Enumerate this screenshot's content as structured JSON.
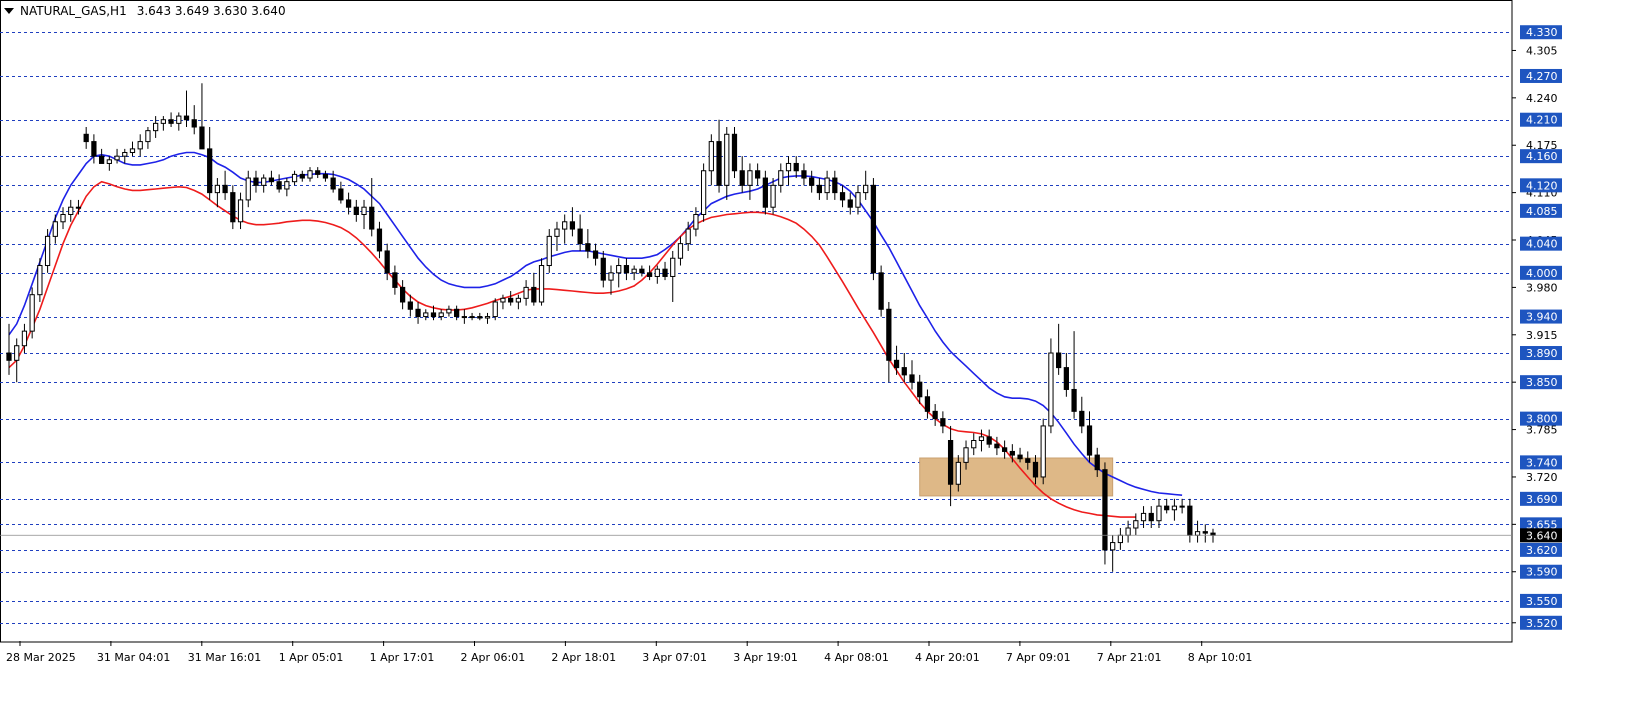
{
  "header": {
    "symbol": "NATURAL_GAS,H1",
    "ohlc": "3.643 3.649 3.630 3.640"
  },
  "colors": {
    "background": "#ffffff",
    "grid": "#1f3fbf",
    "candle": "#000000",
    "ma_fast": "#1e22e8",
    "ma_slow": "#ee1c1c",
    "zone": "#deb887",
    "label_bg": "#1e55c0",
    "price_label_bg": "#000000"
  },
  "chart_data": {
    "type": "candlestick",
    "ylim": [
      3.495,
      4.355
    ],
    "y_ticks": [
      "4.305",
      "4.240",
      "4.175",
      "4.110",
      "4.045",
      "3.980",
      "3.915",
      "3.850",
      "3.785",
      "3.720",
      "3.655",
      "3.590",
      "3.520"
    ],
    "h_lines": [
      "4.330",
      "4.270",
      "4.210",
      "4.160",
      "4.120",
      "4.085",
      "4.040",
      "4.000",
      "3.940",
      "3.890",
      "3.850",
      "3.800",
      "3.740",
      "3.690",
      "3.655",
      "3.620",
      "3.590",
      "3.550",
      "3.520"
    ],
    "current_price": "3.640",
    "x_labels": [
      "28 Mar 2025",
      "31 Mar 04:01",
      "31 Mar 16:01",
      "1 Apr 05:01",
      "1 Apr 17:01",
      "2 Apr 06:01",
      "2 Apr 18:01",
      "3 Apr 07:01",
      "3 Apr 19:01",
      "4 Apr 08:01",
      "4 Apr 20:01",
      "7 Apr 09:01",
      "7 Apr 21:01",
      "8 Apr 10:01"
    ],
    "candles": [
      [
        3.89,
        3.93,
        3.86,
        3.88
      ],
      [
        3.88,
        3.91,
        3.85,
        3.9
      ],
      [
        3.9,
        3.93,
        3.89,
        3.92
      ],
      [
        3.92,
        3.98,
        3.91,
        3.97
      ],
      [
        3.97,
        4.02,
        3.96,
        4.01
      ],
      [
        4.01,
        4.06,
        4.0,
        4.05
      ],
      [
        4.05,
        4.08,
        4.04,
        4.07
      ],
      [
        4.07,
        4.09,
        4.06,
        4.08
      ],
      [
        4.08,
        4.1,
        4.07,
        4.09
      ],
      [
        4.09,
        4.1,
        4.08,
        4.09
      ],
      [
        4.19,
        4.2,
        4.17,
        4.18
      ],
      [
        4.18,
        4.19,
        4.15,
        4.16
      ],
      [
        4.16,
        4.17,
        4.15,
        4.15
      ],
      [
        4.15,
        4.16,
        4.14,
        4.155
      ],
      [
        4.155,
        4.17,
        4.15,
        4.16
      ],
      [
        4.16,
        4.17,
        4.15,
        4.165
      ],
      [
        4.165,
        4.18,
        4.16,
        4.17
      ],
      [
        4.17,
        4.19,
        4.16,
        4.18
      ],
      [
        4.18,
        4.2,
        4.17,
        4.195
      ],
      [
        4.195,
        4.215,
        4.185,
        4.205
      ],
      [
        4.205,
        4.215,
        4.195,
        4.21
      ],
      [
        4.21,
        4.22,
        4.2,
        4.205
      ],
      [
        4.205,
        4.22,
        4.195,
        4.215
      ],
      [
        4.215,
        4.25,
        4.2,
        4.21
      ],
      [
        4.21,
        4.23,
        4.19,
        4.2
      ],
      [
        4.2,
        4.26,
        4.19,
        4.17
      ],
      [
        4.17,
        4.2,
        4.1,
        4.11
      ],
      [
        4.11,
        4.13,
        4.09,
        4.12
      ],
      [
        4.12,
        4.14,
        4.1,
        4.11
      ],
      [
        4.11,
        4.12,
        4.06,
        4.07
      ],
      [
        4.07,
        4.11,
        4.06,
        4.1
      ],
      [
        4.1,
        4.14,
        4.09,
        4.13
      ],
      [
        4.13,
        4.14,
        4.11,
        4.12
      ],
      [
        4.12,
        4.135,
        4.11,
        4.13
      ],
      [
        4.13,
        4.14,
        4.12,
        4.125
      ],
      [
        4.125,
        4.135,
        4.11,
        4.115
      ],
      [
        4.115,
        4.13,
        4.105,
        4.125
      ],
      [
        4.125,
        4.14,
        4.12,
        4.135
      ],
      [
        4.135,
        4.14,
        4.125,
        4.13
      ],
      [
        4.13,
        4.145,
        4.125,
        4.14
      ],
      [
        4.14,
        4.145,
        4.13,
        4.135
      ],
      [
        4.135,
        4.14,
        4.125,
        4.13
      ],
      [
        4.13,
        4.14,
        4.11,
        4.115
      ],
      [
        4.115,
        4.125,
        4.095,
        4.1
      ],
      [
        4.1,
        4.11,
        4.08,
        4.09
      ],
      [
        4.09,
        4.1,
        4.07,
        4.08
      ],
      [
        4.08,
        4.1,
        4.06,
        4.09
      ],
      [
        4.09,
        4.13,
        4.05,
        4.06
      ],
      [
        4.06,
        4.07,
        4.02,
        4.03
      ],
      [
        4.03,
        4.04,
        3.99,
        4.0
      ],
      [
        4.0,
        4.01,
        3.97,
        3.98
      ],
      [
        3.98,
        3.99,
        3.95,
        3.96
      ],
      [
        3.96,
        3.97,
        3.94,
        3.95
      ],
      [
        3.95,
        3.96,
        3.93,
        3.94
      ],
      [
        3.94,
        3.95,
        3.935,
        3.945
      ],
      [
        3.945,
        3.955,
        3.935,
        3.94
      ],
      [
        3.94,
        3.95,
        3.935,
        3.945
      ],
      [
        3.945,
        3.955,
        3.94,
        3.95
      ],
      [
        3.95,
        3.955,
        3.935,
        3.94
      ],
      [
        3.94,
        3.95,
        3.93,
        3.94
      ],
      [
        3.94,
        3.945,
        3.935,
        3.94
      ],
      [
        3.94,
        3.945,
        3.935,
        3.938
      ],
      [
        3.938,
        3.945,
        3.93,
        3.94
      ],
      [
        3.94,
        3.965,
        3.935,
        3.96
      ],
      [
        3.96,
        3.97,
        3.95,
        3.965
      ],
      [
        3.965,
        3.975,
        3.955,
        3.96
      ],
      [
        3.96,
        3.97,
        3.95,
        3.965
      ],
      [
        3.965,
        3.99,
        3.955,
        3.98
      ],
      [
        3.98,
        4.0,
        3.955,
        3.96
      ],
      [
        3.96,
        4.02,
        3.955,
        4.01
      ],
      [
        4.01,
        4.06,
        4.0,
        4.05
      ],
      [
        4.05,
        4.07,
        4.03,
        4.06
      ],
      [
        4.06,
        4.08,
        4.04,
        4.07
      ],
      [
        4.07,
        4.09,
        4.05,
        4.06
      ],
      [
        4.06,
        4.08,
        4.03,
        4.04
      ],
      [
        4.04,
        4.06,
        4.02,
        4.03
      ],
      [
        4.03,
        4.04,
        4.01,
        4.02
      ],
      [
        4.02,
        4.03,
        3.98,
        3.99
      ],
      [
        3.99,
        4.01,
        3.97,
        4.0
      ],
      [
        4.0,
        4.02,
        3.98,
        4.01
      ],
      [
        4.01,
        4.02,
        3.99,
        4.0
      ],
      [
        4.0,
        4.01,
        3.99,
        4.005
      ],
      [
        4.005,
        4.01,
        3.995,
        4.0
      ],
      [
        4.0,
        4.01,
        3.99,
        3.995
      ],
      [
        3.995,
        4.01,
        3.985,
        4.005
      ],
      [
        4.005,
        4.015,
        3.99,
        3.995
      ],
      [
        3.995,
        4.03,
        3.96,
        4.02
      ],
      [
        4.02,
        4.05,
        4.01,
        4.04
      ],
      [
        4.04,
        4.07,
        4.03,
        4.06
      ],
      [
        4.06,
        4.09,
        4.05,
        4.08
      ],
      [
        4.08,
        4.15,
        4.07,
        4.14
      ],
      [
        4.14,
        4.19,
        4.12,
        4.18
      ],
      [
        4.18,
        4.21,
        4.11,
        4.12
      ],
      [
        4.12,
        4.2,
        4.1,
        4.19
      ],
      [
        4.19,
        4.2,
        4.13,
        4.14
      ],
      [
        4.14,
        4.16,
        4.11,
        4.12
      ],
      [
        4.12,
        4.15,
        4.1,
        4.14
      ],
      [
        4.14,
        4.15,
        4.12,
        4.13
      ],
      [
        4.13,
        4.14,
        4.08,
        4.09
      ],
      [
        4.09,
        4.13,
        4.08,
        4.12
      ],
      [
        4.12,
        4.15,
        4.11,
        4.14
      ],
      [
        4.14,
        4.16,
        4.12,
        4.15
      ],
      [
        4.15,
        4.16,
        4.13,
        4.14
      ],
      [
        4.14,
        4.15,
        4.12,
        4.13
      ],
      [
        4.13,
        4.14,
        4.11,
        4.12
      ],
      [
        4.12,
        4.13,
        4.1,
        4.11
      ],
      [
        4.11,
        4.14,
        4.1,
        4.13
      ],
      [
        4.13,
        4.14,
        4.1,
        4.11
      ],
      [
        4.11,
        4.12,
        4.09,
        4.1
      ],
      [
        4.1,
        4.11,
        4.08,
        4.09
      ],
      [
        4.09,
        4.12,
        4.08,
        4.11
      ],
      [
        4.11,
        4.14,
        4.1,
        4.12
      ],
      [
        4.12,
        4.13,
        3.99,
        4.0
      ],
      [
        4.0,
        4.01,
        3.94,
        3.95
      ],
      [
        3.95,
        3.96,
        3.85,
        3.88
      ],
      [
        3.88,
        3.9,
        3.86,
        3.87
      ],
      [
        3.87,
        3.89,
        3.85,
        3.86
      ],
      [
        3.86,
        3.88,
        3.84,
        3.85
      ],
      [
        3.85,
        3.86,
        3.82,
        3.83
      ],
      [
        3.83,
        3.84,
        3.8,
        3.81
      ],
      [
        3.81,
        3.82,
        3.79,
        3.8
      ],
      [
        3.8,
        3.81,
        3.78,
        3.79
      ],
      [
        3.77,
        3.79,
        3.68,
        3.71
      ],
      [
        3.71,
        3.75,
        3.7,
        3.74
      ],
      [
        3.74,
        3.77,
        3.73,
        3.76
      ],
      [
        3.76,
        3.78,
        3.75,
        3.77
      ],
      [
        3.77,
        3.785,
        3.755,
        3.775
      ],
      [
        3.775,
        3.785,
        3.76,
        3.765
      ],
      [
        3.765,
        3.775,
        3.75,
        3.76
      ],
      [
        3.76,
        3.77,
        3.745,
        3.755
      ],
      [
        3.755,
        3.765,
        3.74,
        3.75
      ],
      [
        3.75,
        3.76,
        3.74,
        3.745
      ],
      [
        3.745,
        3.755,
        3.73,
        3.74
      ],
      [
        3.74,
        3.75,
        3.71,
        3.72
      ],
      [
        3.72,
        3.8,
        3.71,
        3.79
      ],
      [
        3.79,
        3.91,
        3.78,
        3.89
      ],
      [
        3.89,
        3.93,
        3.86,
        3.87
      ],
      [
        3.87,
        3.89,
        3.83,
        3.84
      ],
      [
        3.84,
        3.92,
        3.8,
        3.81
      ],
      [
        3.81,
        3.83,
        3.78,
        3.79
      ],
      [
        3.79,
        3.81,
        3.74,
        3.75
      ],
      [
        3.75,
        3.76,
        3.72,
        3.73
      ],
      [
        3.73,
        3.74,
        3.6,
        3.62
      ],
      [
        3.62,
        3.64,
        3.59,
        3.63
      ],
      [
        3.63,
        3.65,
        3.62,
        3.64
      ],
      [
        3.64,
        3.66,
        3.63,
        3.65
      ],
      [
        3.65,
        3.67,
        3.64,
        3.66
      ],
      [
        3.66,
        3.68,
        3.65,
        3.67
      ],
      [
        3.67,
        3.68,
        3.65,
        3.66
      ],
      [
        3.66,
        3.69,
        3.65,
        3.68
      ],
      [
        3.68,
        3.69,
        3.67,
        3.675
      ],
      [
        3.675,
        3.69,
        3.66,
        3.68
      ],
      [
        3.68,
        3.69,
        3.67,
        3.68
      ],
      [
        3.68,
        3.69,
        3.63,
        3.64
      ],
      [
        3.64,
        3.66,
        3.63,
        3.645
      ],
      [
        3.645,
        3.655,
        3.63,
        3.643
      ],
      [
        3.643,
        3.649,
        3.63,
        3.64
      ]
    ],
    "series": [
      {
        "name": "",
        "color": "#1e22e8",
        "values": [
          3.915,
          3.93,
          3.955,
          3.985,
          4.015,
          4.045,
          4.075,
          4.1,
          4.12,
          4.135,
          4.15,
          4.16,
          4.162,
          4.16,
          4.155,
          4.15,
          4.148,
          4.148,
          4.15,
          4.152,
          4.155,
          4.16,
          4.163,
          4.165,
          4.165,
          4.162,
          4.158,
          4.15,
          4.145,
          4.138,
          4.13,
          4.126,
          4.124,
          4.124,
          4.126,
          4.128,
          4.13,
          4.132,
          4.134,
          4.135,
          4.136,
          4.136,
          4.135,
          4.132,
          4.128,
          4.122,
          4.115,
          4.105,
          4.095,
          4.08,
          4.065,
          4.05,
          4.035,
          4.02,
          4.008,
          3.998,
          3.99,
          3.985,
          3.982,
          3.98,
          3.98,
          3.98,
          3.982,
          3.985,
          3.99,
          3.995,
          4.002,
          4.01,
          4.015,
          4.018,
          4.022,
          4.025,
          4.028,
          4.03,
          4.03,
          4.03,
          4.028,
          4.026,
          4.024,
          4.022,
          4.02,
          4.02,
          4.02,
          4.022,
          4.025,
          4.032,
          4.04,
          4.05,
          4.062,
          4.075,
          4.085,
          4.095,
          4.1,
          4.105,
          4.108,
          4.11,
          4.112,
          4.115,
          4.12,
          4.125,
          4.13,
          4.132,
          4.133,
          4.133,
          4.132,
          4.13,
          4.128,
          4.125,
          4.12,
          4.112,
          4.1,
          4.085,
          4.07,
          4.052,
          4.035,
          4.015,
          3.995,
          3.975,
          3.955,
          3.938,
          3.92,
          3.905,
          3.892,
          3.882,
          3.872,
          3.862,
          3.852,
          3.842,
          3.835,
          3.83,
          3.828,
          3.828,
          3.827,
          3.824,
          3.818,
          3.808,
          3.795,
          3.78,
          3.765,
          3.752,
          3.74,
          3.732,
          3.725,
          3.72,
          3.715,
          3.71,
          3.706,
          3.703,
          3.7,
          3.698,
          3.697,
          3.696,
          3.695
        ]
      },
      {
        "name": "",
        "color": "#ee1c1c",
        "values": [
          3.87,
          3.88,
          3.9,
          3.925,
          3.95,
          3.98,
          4.01,
          4.04,
          4.065,
          4.085,
          4.105,
          4.118,
          4.125,
          4.122,
          4.118,
          4.115,
          4.113,
          4.113,
          4.114,
          4.115,
          4.116,
          4.117,
          4.118,
          4.117,
          4.113,
          4.108,
          4.1,
          4.092,
          4.085,
          4.078,
          4.072,
          4.068,
          4.066,
          4.066,
          4.067,
          4.068,
          4.07,
          4.071,
          4.072,
          4.072,
          4.071,
          4.069,
          4.066,
          4.062,
          4.056,
          4.048,
          4.038,
          4.027,
          4.015,
          4.002,
          3.99,
          3.978,
          3.968,
          3.96,
          3.955,
          3.952,
          3.95,
          3.949,
          3.949,
          3.95,
          3.952,
          3.955,
          3.958,
          3.962,
          3.965,
          3.968,
          3.972,
          3.976,
          3.978,
          3.978,
          3.978,
          3.977,
          3.976,
          3.975,
          3.974,
          3.973,
          3.972,
          3.972,
          3.973,
          3.975,
          3.978,
          3.982,
          3.99,
          4.0,
          4.012,
          4.025,
          4.038,
          4.05,
          4.06,
          4.067,
          4.072,
          4.076,
          4.078,
          4.08,
          4.081,
          4.082,
          4.083,
          4.083,
          4.082,
          4.08,
          4.077,
          4.073,
          4.068,
          4.06,
          4.05,
          4.038,
          4.022,
          4.005,
          3.988,
          3.97,
          3.952,
          3.935,
          3.918,
          3.9,
          3.882,
          3.866,
          3.85,
          3.836,
          3.822,
          3.81,
          3.8,
          3.792,
          3.786,
          3.783,
          3.782,
          3.781,
          3.779,
          3.775,
          3.768,
          3.758,
          3.745,
          3.732,
          3.72,
          3.708,
          3.698,
          3.69,
          3.684,
          3.679,
          3.675,
          3.672,
          3.67,
          3.668,
          3.667,
          3.666,
          3.665,
          3.665,
          3.665
        ]
      }
    ],
    "zone": {
      "x_start_index": 118,
      "x_end_index": 143,
      "y_top": 3.746,
      "y_bottom": 3.694
    }
  }
}
